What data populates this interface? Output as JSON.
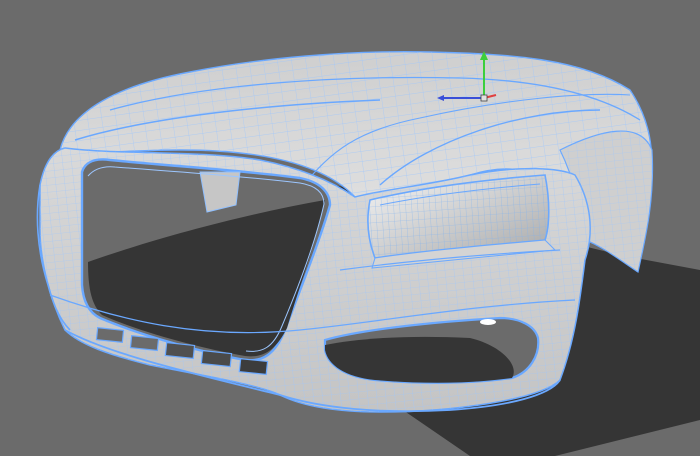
{
  "viewport": {
    "background_color": "#6b6b6b",
    "ground_shadow_color": "#363636",
    "surface_color": "#d8d8d8",
    "wire_color": "#8fbfff",
    "wire_color_strong": "#6aa8ff",
    "model": "car-front-mesh-wireframe",
    "selection_state": "selected",
    "gizmo": {
      "type": "translate",
      "axes": [
        "x",
        "y",
        "z"
      ],
      "axis_colors": {
        "x": "#e04040",
        "y": "#3ccf3c",
        "z": "#3a4fd8"
      }
    }
  }
}
